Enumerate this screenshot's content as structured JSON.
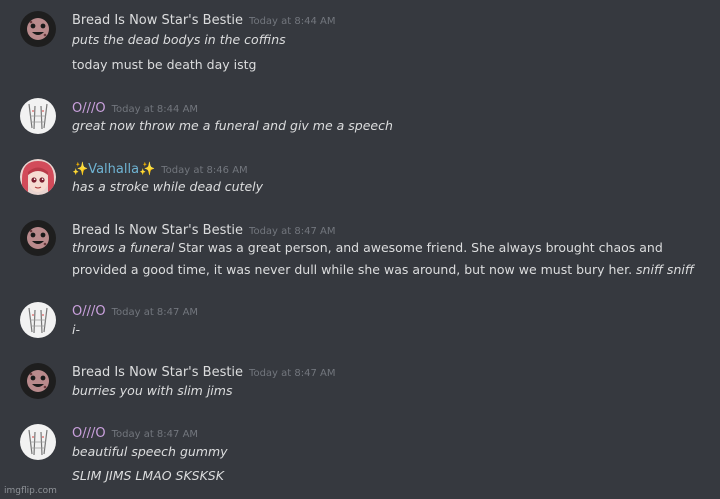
{
  "colors": {
    "background": "#36393f",
    "text": "#dcddde",
    "timestamp": "#72767d",
    "bread_name": "#dcddde",
    "o_name": "#c9a0dc",
    "valhalla_name": "#6fb3d2"
  },
  "messages": [
    {
      "avatar": "cookie-face-avatar",
      "username": "Bread Is Now Star's Bestie",
      "timestamp": "Today at 8:44 AM",
      "lines": [
        {
          "text": "puts the dead bodys in the coffins"
        },
        {
          "text": "today must be death day istg"
        }
      ]
    },
    {
      "avatar": "sketch-avatar",
      "username": "O///O",
      "timestamp": "Today at 8:44 AM",
      "lines": [
        {
          "text": "great now throw me a funeral and giv me a speech"
        }
      ]
    },
    {
      "avatar": "anime-girl-avatar",
      "username": "✨Valhalla✨",
      "timestamp": "Today at 8:46 AM",
      "lines": [
        {
          "text": "has a stroke while dead cutely"
        }
      ]
    },
    {
      "avatar": "cookie-face-avatar",
      "username": "Bread Is Now Star's Bestie",
      "timestamp": "Today at 8:47 AM",
      "lines": [
        {
          "italic_start": "throws a funeral",
          "body_1": " Star was a great person, and awesome friend. She always brought chaos and",
          "body_2": "provided a good time, it was never dull while she was around, but now we must bury her. ",
          "italic_end": "sniff sniff"
        }
      ]
    },
    {
      "avatar": "sketch-avatar",
      "username": "O///O",
      "timestamp": "Today at 8:47 AM",
      "lines": [
        {
          "text": "i-"
        }
      ]
    },
    {
      "avatar": "cookie-face-avatar",
      "username": "Bread Is Now Star's Bestie",
      "timestamp": "Today at 8:47 AM",
      "lines": [
        {
          "text": "burries you with slim jims"
        }
      ]
    },
    {
      "avatar": "sketch-avatar",
      "username": "O///O",
      "timestamp": "Today at 8:47 AM",
      "lines": [
        {
          "text": "beautiful speech gummy"
        },
        {
          "text": "SLIM JIMS  LMAO SKSKSK"
        }
      ]
    }
  ],
  "watermark": "imgflip.com"
}
